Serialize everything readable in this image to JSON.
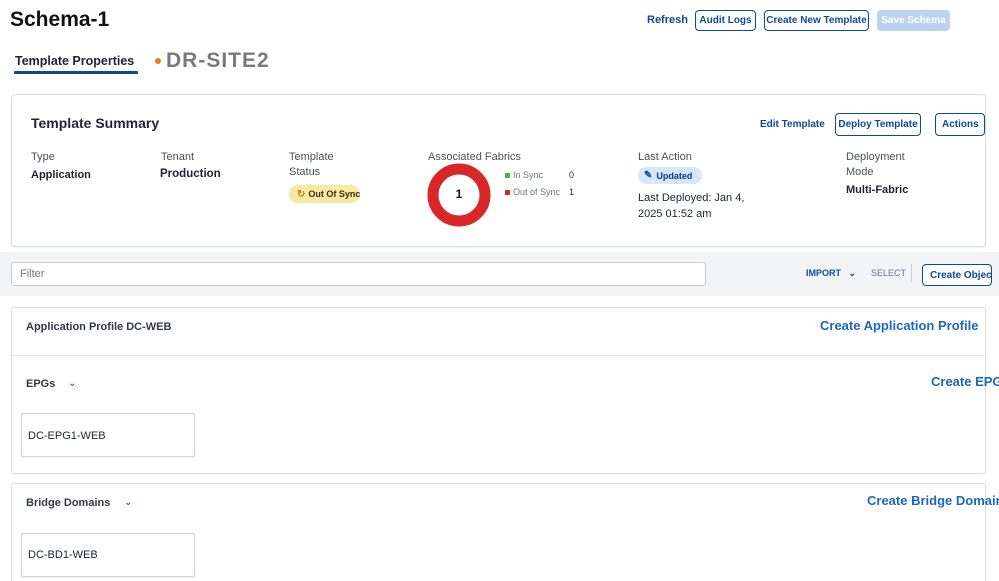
{
  "header": {
    "title": "Schema-1",
    "refresh_label": "Refresh",
    "audit_logs_label": "Audit Logs",
    "create_template_label": "Create New Template",
    "save_schema_label": "Save Schema"
  },
  "tabs": {
    "properties_label": "Template Properties",
    "site_name": "DR-SITE2"
  },
  "summary": {
    "title": "Template Summary",
    "edit_template_label": "Edit Template",
    "deploy_template_label": "Deploy Template",
    "actions_label": "Actions",
    "type_label": "Type",
    "type_value": "Application",
    "tenant_label": "Tenant",
    "tenant_value": "Production",
    "status_label_1": "Template",
    "status_label_2": "Status",
    "status_value": "Out Of Sync",
    "fabrics_label": "Associated Fabrics",
    "fabrics_total": "1",
    "in_sync_label": "In Sync",
    "in_sync_count": "0",
    "out_sync_label": "Out of Sync",
    "out_sync_count": "1",
    "last_action_label": "Last Action",
    "last_action_value": "Updated",
    "last_deployed": "Last Deployed: Jan 4, 2025 01:52 am",
    "mode_label_1": "Deployment",
    "mode_label_2": "Mode",
    "mode_value": "Multi-Fabric"
  },
  "toolbar": {
    "filter_placeholder": "Filter",
    "import_label": "IMPORT",
    "select_label": "SELECT",
    "create_object_label": "Create Object"
  },
  "sections": {
    "app_profile": {
      "title": "Application Profile DC-WEB",
      "create_label": "Create Application Profile"
    },
    "epgs": {
      "title": "EPGs",
      "create_label": "Create EPG",
      "items": [
        "DC-EPG1-WEB"
      ]
    },
    "bridge_domains": {
      "title": "Bridge Domains",
      "create_label": "Create Bridge Domain",
      "items": [
        "DC-BD1-WEB"
      ]
    }
  },
  "colors": {
    "primary": "#0d4a96",
    "in_sync": "#4caf50",
    "out_sync": "#d92626",
    "status_warning_bg": "#f9e7a6",
    "accent_dot": "#e8772e"
  }
}
